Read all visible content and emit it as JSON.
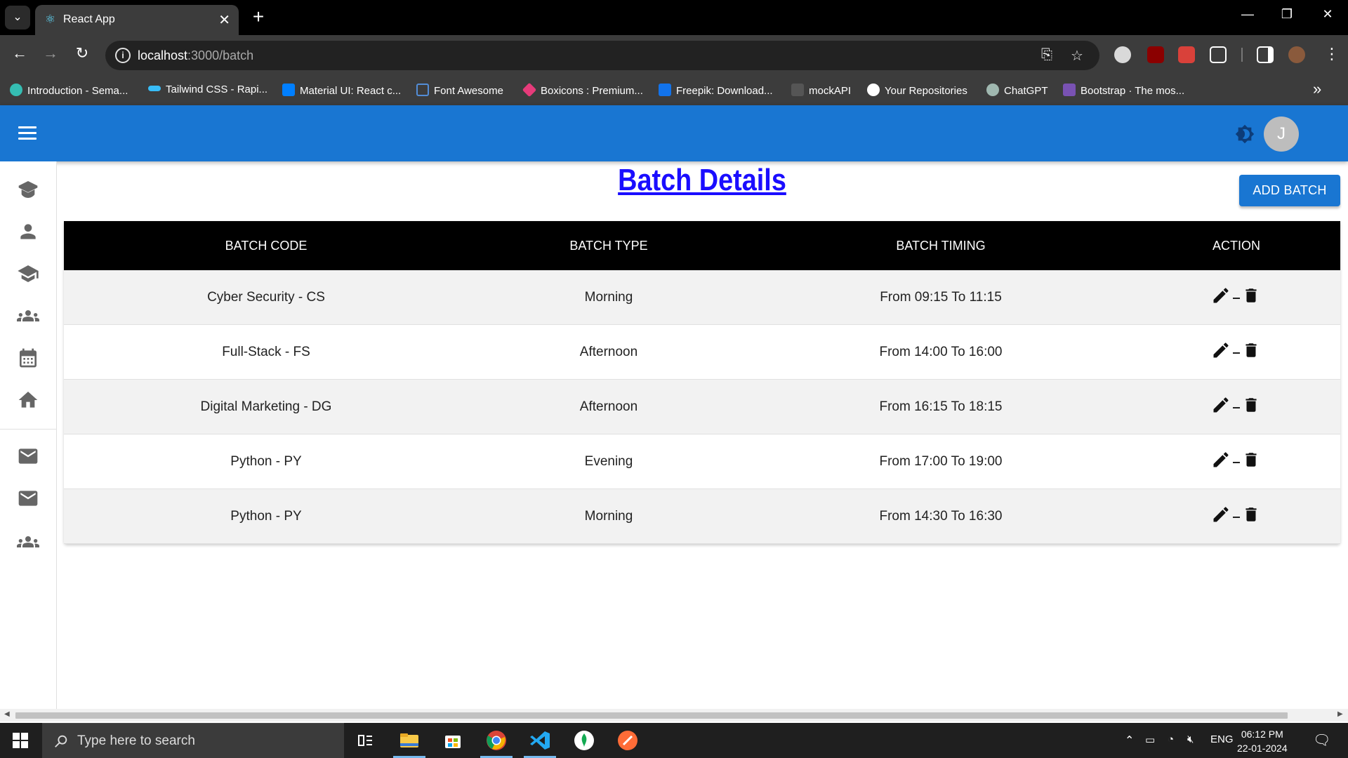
{
  "browser": {
    "tab_title": "React App",
    "url_host": "localhost",
    "url_path": ":3000/batch",
    "bookmarks": [
      {
        "label": "Introduction - Sema...",
        "color": "#35bdb2"
      },
      {
        "label": "Tailwind CSS - Rapi...",
        "color": "#38bdf8"
      },
      {
        "label": "Material UI: React c...",
        "color": "#007fff"
      },
      {
        "label": "Font Awesome",
        "color": "#538dd7"
      },
      {
        "label": "Boxicons : Premium...",
        "color": "#e63b7a"
      },
      {
        "label": "Freepik: Download...",
        "color": "#1273eb"
      },
      {
        "label": "mockAPI",
        "color": "#888888"
      },
      {
        "label": "Your Repositories",
        "color": "#ffffff"
      },
      {
        "label": "ChatGPT",
        "color": "#a0b8b0"
      },
      {
        "label": "Bootstrap · The mos...",
        "color": "#7952b3"
      }
    ]
  },
  "app": {
    "avatar_letter": "J",
    "page_title": "Batch Details",
    "add_button": "ADD BATCH",
    "brand_color": "#1976d2",
    "sidebar_icons": [
      "book-icon",
      "person-icon",
      "graduation-cap-icon",
      "groups-icon",
      "calendar-icon",
      "home-icon",
      "mail-icon",
      "mail-icon",
      "groups-icon"
    ]
  },
  "table": {
    "headers": [
      "BATCH CODE",
      "BATCH TYPE",
      "BATCH TIMING",
      "ACTION"
    ],
    "rows": [
      {
        "code": "Cyber Security - CS",
        "type": "Morning",
        "timing": "From 09:15 To 11:15"
      },
      {
        "code": "Full-Stack - FS",
        "type": "Afternoon",
        "timing": "From 14:00 To 16:00"
      },
      {
        "code": "Digital Marketing - DG",
        "type": "Afternoon",
        "timing": "From 16:15 To 18:15"
      },
      {
        "code": "Python - PY",
        "type": "Evening",
        "timing": "From 17:00 To 19:00"
      },
      {
        "code": "Python - PY",
        "type": "Morning",
        "timing": "From 14:30 To 16:30"
      }
    ]
  },
  "taskbar": {
    "search_placeholder": "Type here to search",
    "language": "ENG",
    "time": "06:12 PM",
    "date": "22-01-2024"
  }
}
